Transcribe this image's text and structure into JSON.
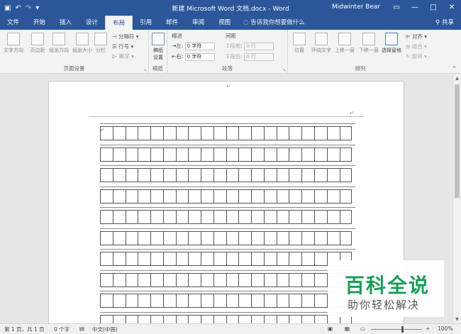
{
  "titlebar": {
    "save_icon": "save-icon",
    "undo_icon": "undo-icon",
    "redo_icon": "redo-icon",
    "title": "新建 Microsoft Word 文档.docx  -  Word",
    "user": "Midwinter Bear",
    "ribbon_opts_icon": "ribbon-display-icon",
    "min": "—",
    "max": "□",
    "close": "✕"
  },
  "tabs": [
    {
      "label": "文件"
    },
    {
      "label": "开始"
    },
    {
      "label": "插入"
    },
    {
      "label": "设计"
    },
    {
      "label": "布局",
      "active": true
    },
    {
      "label": "引用"
    },
    {
      "label": "邮件"
    },
    {
      "label": "审阅"
    },
    {
      "label": "视图"
    }
  ],
  "tell_me": "告诉我你想要做什么",
  "share": "共享",
  "ribbon": {
    "page_setup": {
      "label": "页面设置",
      "buttons": [
        "文字方向",
        "页边距",
        "纸张方向",
        "纸张大小",
        "分栏"
      ],
      "small": [
        "分隔符",
        "行号",
        "断字"
      ]
    },
    "manuscript": {
      "label": "稿纸",
      "button": "稿纸\n设置",
      "button_line1": "稿纸",
      "button_line2": "设置"
    },
    "paragraph": {
      "label": "段落",
      "indent": "缩进",
      "spacing": "间距",
      "left": "左:",
      "right": "右:",
      "before": "段前:",
      "after": "段后:",
      "left_value": "0 字符",
      "right_value": "0 字符",
      "before_value": "0 行",
      "after_value": "0 行"
    },
    "arrange": {
      "label": "排列",
      "buttons": [
        "位置",
        "环绕文字",
        "上移一层",
        "下移一层",
        "选择窗格"
      ],
      "small": [
        "对齐",
        "组合",
        "旋转"
      ]
    }
  },
  "status": {
    "page": "第 1 页，共 1 页",
    "words": "0 个字",
    "lang": "中文(中国)",
    "zoom": "100%"
  },
  "watermark": {
    "title": "百科全说",
    "subtitle": "助你轻松解决"
  },
  "colors": {
    "accent": "#2b579a",
    "watermark_green": "#1c9c5a"
  }
}
